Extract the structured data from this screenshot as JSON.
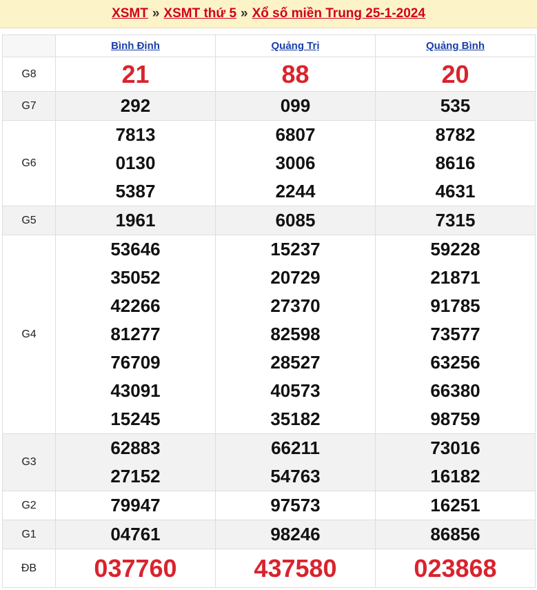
{
  "header": {
    "link1": "XSMT",
    "sep": "»",
    "link2": "XSMT thứ 5",
    "link3": "Xổ số miền Trung 25-1-2024"
  },
  "provinces": [
    "Bình Định",
    "Quảng Trị",
    "Quảng Bình"
  ],
  "prizes": [
    {
      "label": "G8",
      "values": [
        [
          "21"
        ],
        [
          "88"
        ],
        [
          "20"
        ]
      ]
    },
    {
      "label": "G7",
      "values": [
        [
          "292"
        ],
        [
          "099"
        ],
        [
          "535"
        ]
      ]
    },
    {
      "label": "G6",
      "values": [
        [
          "7813",
          "0130",
          "5387"
        ],
        [
          "6807",
          "3006",
          "2244"
        ],
        [
          "8782",
          "8616",
          "4631"
        ]
      ]
    },
    {
      "label": "G5",
      "values": [
        [
          "1961"
        ],
        [
          "6085"
        ],
        [
          "7315"
        ]
      ]
    },
    {
      "label": "G4",
      "values": [
        [
          "53646",
          "35052",
          "42266",
          "81277",
          "76709",
          "43091",
          "15245"
        ],
        [
          "15237",
          "20729",
          "27370",
          "82598",
          "28527",
          "40573",
          "35182"
        ],
        [
          "59228",
          "21871",
          "91785",
          "73577",
          "63256",
          "66380",
          "98759"
        ]
      ]
    },
    {
      "label": "G3",
      "values": [
        [
          "62883",
          "27152"
        ],
        [
          "66211",
          "54763"
        ],
        [
          "73016",
          "16182"
        ]
      ]
    },
    {
      "label": "G2",
      "values": [
        [
          "79947"
        ],
        [
          "97573"
        ],
        [
          "16251"
        ]
      ]
    },
    {
      "label": "G1",
      "values": [
        [
          "04761"
        ],
        [
          "98246"
        ],
        [
          "86856"
        ]
      ]
    },
    {
      "label": "ĐB",
      "values": [
        [
          "037760"
        ],
        [
          "437580"
        ],
        [
          "023868"
        ]
      ]
    }
  ],
  "colors": {
    "accent": "#d9232e",
    "link": "#1a3fa8",
    "header_bg": "#fdf3c8"
  }
}
